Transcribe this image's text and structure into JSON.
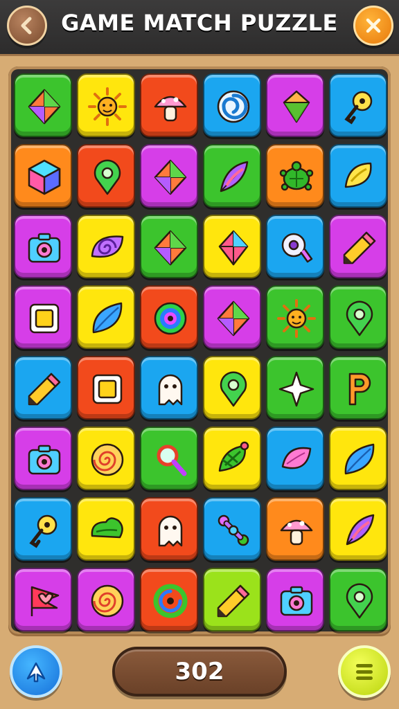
{
  "header": {
    "title": "GAME MATCH PUZZLE",
    "back_icon": "chevron-left-icon",
    "close_icon": "close-icon"
  },
  "score": {
    "value": "302"
  },
  "colors": {
    "green": "#3cc42d",
    "yellow": "#ffe60d",
    "red": "#f24a1c",
    "blue": "#1ba6f0",
    "purple": "#d63ee8",
    "orange": "#ff8a1c",
    "lime": "#9be21b",
    "board": "#2f2e2c"
  },
  "board": {
    "rows": [
      [
        {
          "color": "green",
          "icon": "kite-icon"
        },
        {
          "color": "yellow",
          "icon": "sun-icon"
        },
        {
          "color": "red",
          "icon": "mushroom-icon"
        },
        {
          "color": "blue",
          "icon": "swirl-icon"
        },
        {
          "color": "purple",
          "icon": "gem-icon"
        },
        {
          "color": "blue",
          "icon": "key-icon"
        }
      ],
      [
        {
          "color": "orange",
          "icon": "cube-icon"
        },
        {
          "color": "red",
          "icon": "map-pin-icon"
        },
        {
          "color": "purple",
          "icon": "kite-icon"
        },
        {
          "color": "green",
          "icon": "feather-icon"
        },
        {
          "color": "orange",
          "icon": "turtle-icon"
        },
        {
          "color": "blue",
          "icon": "lemon-icon"
        }
      ],
      [
        {
          "color": "purple",
          "icon": "camera-icon"
        },
        {
          "color": "yellow",
          "icon": "spiral-leaf-icon"
        },
        {
          "color": "green",
          "icon": "kite-icon"
        },
        {
          "color": "yellow",
          "icon": "diamond-icon"
        },
        {
          "color": "blue",
          "icon": "whistle-icon"
        },
        {
          "color": "purple",
          "icon": "pencil-icon"
        }
      ],
      [
        {
          "color": "purple",
          "icon": "square-icon"
        },
        {
          "color": "yellow",
          "icon": "leaf-icon"
        },
        {
          "color": "red",
          "icon": "target-icon"
        },
        {
          "color": "purple",
          "icon": "kite-icon"
        },
        {
          "color": "green",
          "icon": "sun-icon"
        },
        {
          "color": "green",
          "icon": "map-pin-icon"
        }
      ],
      [
        {
          "color": "blue",
          "icon": "pencil-icon"
        },
        {
          "color": "red",
          "icon": "square-icon"
        },
        {
          "color": "blue",
          "icon": "ghost-icon"
        },
        {
          "color": "yellow",
          "icon": "map-pin-icon"
        },
        {
          "color": "green",
          "icon": "star-icon"
        },
        {
          "color": "green",
          "icon": "letter-p-icon"
        }
      ],
      [
        {
          "color": "purple",
          "icon": "camera-icon"
        },
        {
          "color": "yellow",
          "icon": "spiral-icon"
        },
        {
          "color": "green",
          "icon": "magnifier-icon"
        },
        {
          "color": "yellow",
          "icon": "bug-icon"
        },
        {
          "color": "blue",
          "icon": "petal-icon"
        },
        {
          "color": "yellow",
          "icon": "leaf-icon"
        }
      ],
      [
        {
          "color": "blue",
          "icon": "key-icon"
        },
        {
          "color": "yellow",
          "icon": "cloud-leaf-icon"
        },
        {
          "color": "red",
          "icon": "ghost-icon"
        },
        {
          "color": "blue",
          "icon": "bone-icon"
        },
        {
          "color": "orange",
          "icon": "mushroom-icon"
        },
        {
          "color": "yellow",
          "icon": "feather-icon"
        }
      ],
      [
        {
          "color": "purple",
          "icon": "heart-flag-icon"
        },
        {
          "color": "purple",
          "icon": "spiral-icon"
        },
        {
          "color": "red",
          "icon": "spiral-g-icon"
        },
        {
          "color": "lime",
          "icon": "pencil-icon"
        },
        {
          "color": "purple",
          "icon": "camera-icon"
        },
        {
          "color": "green",
          "icon": "map-pin-icon"
        }
      ]
    ]
  },
  "footer": {
    "share_icon": "share-arrow-icon",
    "menu_icon": "menu-list-icon"
  }
}
